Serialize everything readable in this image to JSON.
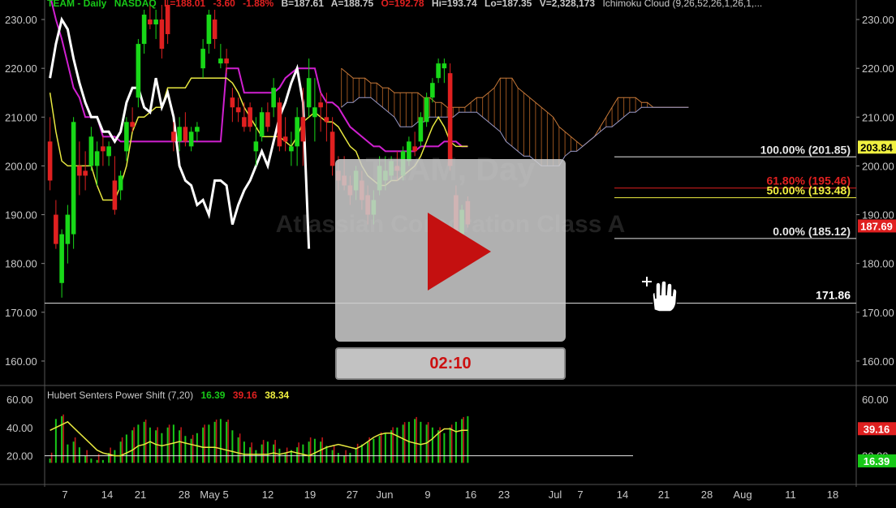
{
  "header": {
    "symbol": "TEAM - Daily",
    "exchange": "NASDAQ",
    "last": "L=188.01",
    "change": "-3.60",
    "change_pct": "-1.88%",
    "bid": "B=187.61",
    "ask": "A=188.75",
    "open": "O=192.78",
    "high": "Hi=193.74",
    "low": "Lo=187.35",
    "volume": "V=2,328,173",
    "study": "Ichimoku Cloud (9,26,52,26,1,26,1,..."
  },
  "watermark": {
    "ticker": "TEAM, Day",
    "name": "Atlassian Corporation Class A"
  },
  "price_axis": {
    "ticks": [
      "230.00",
      "220.00",
      "210.00",
      "200.00",
      "190.00",
      "180.00",
      "170.00",
      "160.00"
    ],
    "ylim": [
      155,
      234
    ]
  },
  "fib_levels": [
    {
      "label": "100.00% (201.85)",
      "value": 201.85,
      "color": "#e6e6e6"
    },
    {
      "label": "61.80% (195.46)",
      "value": 195.46,
      "color": "#e02020"
    },
    {
      "label": "50.00% (193.48)",
      "value": 193.48,
      "color": "#f0f040"
    },
    {
      "label": "0.00% (185.12)",
      "value": 185.12,
      "color": "#e6e6e6"
    }
  ],
  "support": {
    "label": "171.86",
    "value": 171.86
  },
  "price_tags": [
    {
      "label": "203.84",
      "value": 203.84,
      "bg": "#f0f040",
      "fg": "#000"
    },
    {
      "label": "187.69",
      "value": 187.69,
      "bg": "#e02020",
      "fg": "#fff"
    }
  ],
  "x_axis": {
    "ticks": [
      "7",
      "14",
      "21",
      "28",
      "May 5",
      "12",
      "19",
      "27",
      "Jun",
      "9",
      "16",
      "23",
      "Jul",
      "7",
      "14",
      "21",
      "28",
      "Aug",
      "11",
      "18"
    ]
  },
  "indicator": {
    "title": "Hubert Senters Power Shift (7,20)",
    "v1": "16.39",
    "v2": "39.16",
    "v3": "38.34",
    "ticks": [
      "60.00",
      "40.00",
      "20.00"
    ],
    "ylim": [
      2,
      68
    ],
    "tags": [
      {
        "label": "39.16",
        "value": 39.16,
        "bg": "#e02020"
      },
      {
        "label": "16.39",
        "value": 16.39,
        "bg": "#18c818"
      }
    ]
  },
  "video": {
    "timer": "02:10"
  },
  "chart_data": {
    "type": "candlestick",
    "title": "TEAM - Daily",
    "candles": [
      {
        "o": 205,
        "h": 210,
        "l": 195,
        "c": 197
      },
      {
        "o": 190,
        "h": 193,
        "l": 183,
        "c": 184
      },
      {
        "o": 176,
        "h": 187,
        "l": 173,
        "c": 186
      },
      {
        "o": 184,
        "h": 192,
        "l": 180,
        "c": 190
      },
      {
        "o": 186,
        "h": 210,
        "l": 183,
        "c": 209
      },
      {
        "o": 200,
        "h": 205,
        "l": 194,
        "c": 198
      },
      {
        "o": 199,
        "h": 203,
        "l": 195,
        "c": 198
      },
      {
        "o": 200,
        "h": 208,
        "l": 199,
        "c": 206
      },
      {
        "o": 200,
        "h": 205,
        "l": 196,
        "c": 203
      },
      {
        "o": 204,
        "h": 206,
        "l": 200,
        "c": 203
      },
      {
        "o": 202,
        "h": 205,
        "l": 200,
        "c": 204
      },
      {
        "o": 197,
        "h": 202,
        "l": 190,
        "c": 191
      },
      {
        "o": 195,
        "h": 199,
        "l": 193,
        "c": 198
      },
      {
        "o": 203,
        "h": 210,
        "l": 201,
        "c": 209
      },
      {
        "o": 209,
        "h": 212,
        "l": 207,
        "c": 208
      },
      {
        "o": 214,
        "h": 226,
        "l": 212,
        "c": 225
      },
      {
        "o": 225,
        "h": 232,
        "l": 223,
        "c": 231
      },
      {
        "o": 230,
        "h": 234,
        "l": 228,
        "c": 229
      },
      {
        "o": 229,
        "h": 232,
        "l": 226,
        "c": 230
      },
      {
        "o": 230,
        "h": 233,
        "l": 222,
        "c": 224
      },
      {
        "o": 233,
        "h": 236,
        "l": 225,
        "c": 227
      },
      {
        "o": 207,
        "h": 209,
        "l": 203,
        "c": 205
      },
      {
        "o": 205,
        "h": 210,
        "l": 203,
        "c": 208
      },
      {
        "o": 208,
        "h": 211,
        "l": 204,
        "c": 205
      },
      {
        "o": 204,
        "h": 208,
        "l": 203,
        "c": 207
      },
      {
        "o": 207,
        "h": 209,
        "l": 205,
        "c": 208
      },
      {
        "o": 220,
        "h": 226,
        "l": 218,
        "c": 224
      },
      {
        "o": 225,
        "h": 232,
        "l": 223,
        "c": 231
      },
      {
        "o": 230,
        "h": 232,
        "l": 224,
        "c": 226
      },
      {
        "o": 221,
        "h": 225,
        "l": 220,
        "c": 222
      },
      {
        "o": 222,
        "h": 224,
        "l": 219,
        "c": 221
      },
      {
        "o": 214,
        "h": 216,
        "l": 209,
        "c": 212
      },
      {
        "o": 212,
        "h": 214,
        "l": 209,
        "c": 211
      },
      {
        "o": 210,
        "h": 213,
        "l": 207,
        "c": 208
      },
      {
        "o": 212,
        "h": 213,
        "l": 207,
        "c": 208
      },
      {
        "o": 203,
        "h": 210,
        "l": 200,
        "c": 205
      },
      {
        "o": 206,
        "h": 212,
        "l": 205,
        "c": 211
      },
      {
        "o": 211,
        "h": 213,
        "l": 207,
        "c": 208
      },
      {
        "o": 212,
        "h": 218,
        "l": 210,
        "c": 216
      },
      {
        "o": 213,
        "h": 214,
        "l": 203,
        "c": 204
      },
      {
        "o": 206,
        "h": 210,
        "l": 203,
        "c": 205
      },
      {
        "o": 203,
        "h": 207,
        "l": 200,
        "c": 204
      },
      {
        "o": 204,
        "h": 212,
        "l": 200,
        "c": 210
      },
      {
        "o": 210,
        "h": 216,
        "l": 200,
        "c": 205
      },
      {
        "o": 212,
        "h": 222,
        "l": 210,
        "c": 218
      },
      {
        "o": 210,
        "h": 218,
        "l": 205,
        "c": 212
      },
      {
        "o": 213,
        "h": 215,
        "l": 207,
        "c": 212
      },
      {
        "o": 210,
        "h": 215,
        "l": 205,
        "c": 209
      },
      {
        "o": 207,
        "h": 210,
        "l": 198,
        "c": 200
      },
      {
        "o": 199,
        "h": 202,
        "l": 195,
        "c": 197
      },
      {
        "o": 198,
        "h": 202,
        "l": 195,
        "c": 196
      },
      {
        "o": 196,
        "h": 198,
        "l": 192,
        "c": 194
      },
      {
        "o": 195,
        "h": 200,
        "l": 193,
        "c": 199
      },
      {
        "o": 197,
        "h": 199,
        "l": 191,
        "c": 193
      },
      {
        "o": 194,
        "h": 196,
        "l": 188,
        "c": 190
      },
      {
        "o": 190,
        "h": 195,
        "l": 188,
        "c": 193
      },
      {
        "o": 195,
        "h": 202,
        "l": 194,
        "c": 200
      },
      {
        "o": 197,
        "h": 202,
        "l": 195,
        "c": 199
      },
      {
        "o": 198,
        "h": 202,
        "l": 197,
        "c": 201
      },
      {
        "o": 200,
        "h": 203,
        "l": 197,
        "c": 199
      },
      {
        "o": 198,
        "h": 204,
        "l": 197,
        "c": 203
      },
      {
        "o": 201,
        "h": 206,
        "l": 200,
        "c": 205
      },
      {
        "o": 204,
        "h": 207,
        "l": 202,
        "c": 203
      },
      {
        "o": 205,
        "h": 211,
        "l": 204,
        "c": 210
      },
      {
        "o": 209,
        "h": 215,
        "l": 208,
        "c": 214
      },
      {
        "o": 214,
        "h": 218,
        "l": 213,
        "c": 217
      },
      {
        "o": 218,
        "h": 222,
        "l": 217,
        "c": 221
      },
      {
        "o": 220,
        "h": 222,
        "l": 217,
        "c": 221
      },
      {
        "o": 219,
        "h": 221,
        "l": 199,
        "c": 200
      },
      {
        "o": 194,
        "h": 196,
        "l": 185,
        "c": 186
      },
      {
        "o": 186,
        "h": 192,
        "l": 185,
        "c": 191
      },
      {
        "o": 192.78,
        "h": 193.74,
        "l": 187.35,
        "c": 188.01
      }
    ],
    "tenkan_yellow": [
      215,
      207,
      201,
      200,
      200,
      200,
      200,
      200,
      196,
      193,
      193,
      193,
      196,
      200,
      207,
      210,
      210,
      211,
      212,
      212,
      216,
      216,
      216,
      216,
      218,
      218,
      218,
      218,
      218,
      218,
      218,
      217,
      215,
      212,
      210,
      208,
      206,
      206,
      206,
      206,
      205,
      204,
      206,
      209,
      210,
      211,
      210,
      209,
      209,
      208,
      206,
      204,
      203,
      200,
      198,
      197,
      196,
      196,
      197,
      197,
      198,
      199,
      200,
      202,
      205,
      208,
      210,
      208,
      205,
      204,
      204,
      204
    ],
    "kijun_magenta": [
      235,
      230,
      226,
      221,
      216,
      214,
      210,
      210,
      210,
      206,
      206,
      206,
      205,
      205,
      205,
      205,
      205,
      205,
      205,
      205,
      205,
      205,
      205,
      205,
      205,
      205,
      205,
      205,
      205,
      205,
      220,
      220,
      220,
      215,
      215,
      215,
      215,
      215,
      215,
      216,
      218,
      219,
      220,
      220,
      220,
      220,
      215,
      213,
      213,
      212,
      210,
      208,
      207,
      206,
      205,
      204,
      204,
      203,
      203,
      203,
      203,
      203,
      203,
      204,
      204,
      204,
      204,
      205,
      205,
      205,
      204,
      204
    ],
    "chikou_white": [
      218,
      225,
      230,
      228,
      222,
      217,
      213,
      210,
      210,
      207,
      207,
      205,
      207,
      213,
      216,
      216,
      212,
      211,
      218,
      212,
      215,
      210,
      200,
      197,
      196,
      192,
      193,
      190,
      197,
      197,
      196,
      188,
      192,
      195,
      197,
      200,
      203,
      200,
      205,
      210,
      213,
      217,
      220,
      213,
      183
    ],
    "cloud_top": [
      220,
      219,
      218,
      218,
      218,
      217,
      217,
      216,
      216,
      215,
      215,
      215,
      215,
      215,
      214,
      214,
      213,
      213,
      212,
      212,
      212,
      212,
      213,
      214,
      214,
      215,
      216,
      218,
      218,
      218,
      216,
      215,
      214,
      213,
      212,
      211,
      210,
      208,
      207,
      206,
      205,
      204,
      205,
      206,
      208,
      210,
      212,
      214,
      214,
      214,
      214,
      213,
      213,
      212,
      212,
      212,
      212,
      212,
      212,
      212
    ],
    "cloud_bottom": [
      212,
      213,
      213,
      214,
      214,
      214,
      213,
      212,
      211,
      210,
      208,
      208,
      208,
      209,
      209,
      210,
      210,
      210,
      210,
      210,
      211,
      211,
      211,
      211,
      210,
      209,
      208,
      207,
      205,
      204,
      203,
      202,
      202,
      201,
      200,
      200,
      200,
      200,
      202,
      203,
      203,
      204,
      205,
      206,
      207,
      208,
      208,
      209,
      210,
      211,
      211,
      212,
      212,
      212,
      212,
      212,
      212,
      212,
      212,
      212
    ],
    "indicator_bars": [
      18,
      46,
      48,
      28,
      30,
      26,
      20,
      18,
      17,
      17,
      22,
      24,
      30,
      35,
      38,
      42,
      44,
      40,
      38,
      36,
      40,
      42,
      38,
      34,
      32,
      36,
      40,
      42,
      44,
      46,
      44,
      38,
      33,
      30,
      26,
      24,
      28,
      30,
      28,
      25,
      22,
      24,
      26,
      28,
      30,
      32,
      30,
      27,
      24,
      22,
      20,
      22,
      25,
      28,
      30,
      32,
      34,
      36,
      38,
      40,
      42,
      44,
      46,
      44,
      42,
      40,
      38,
      36,
      40,
      44,
      46,
      48
    ],
    "indicator_signal": [
      38,
      40,
      42,
      44,
      40,
      36,
      32,
      28,
      24,
      22,
      21,
      20,
      20,
      22,
      24,
      27,
      28,
      30,
      28,
      27,
      28,
      29,
      30,
      29,
      28,
      27,
      26,
      26,
      26,
      25,
      24,
      23,
      22,
      21,
      21,
      21,
      21,
      21,
      22,
      21,
      22,
      23,
      22,
      21,
      20,
      22,
      24,
      26,
      27,
      28,
      27,
      26,
      25,
      27,
      30,
      33,
      35,
      36,
      36,
      34,
      32,
      30,
      29,
      28,
      29,
      32,
      36,
      39,
      39,
      37,
      38,
      38
    ]
  }
}
